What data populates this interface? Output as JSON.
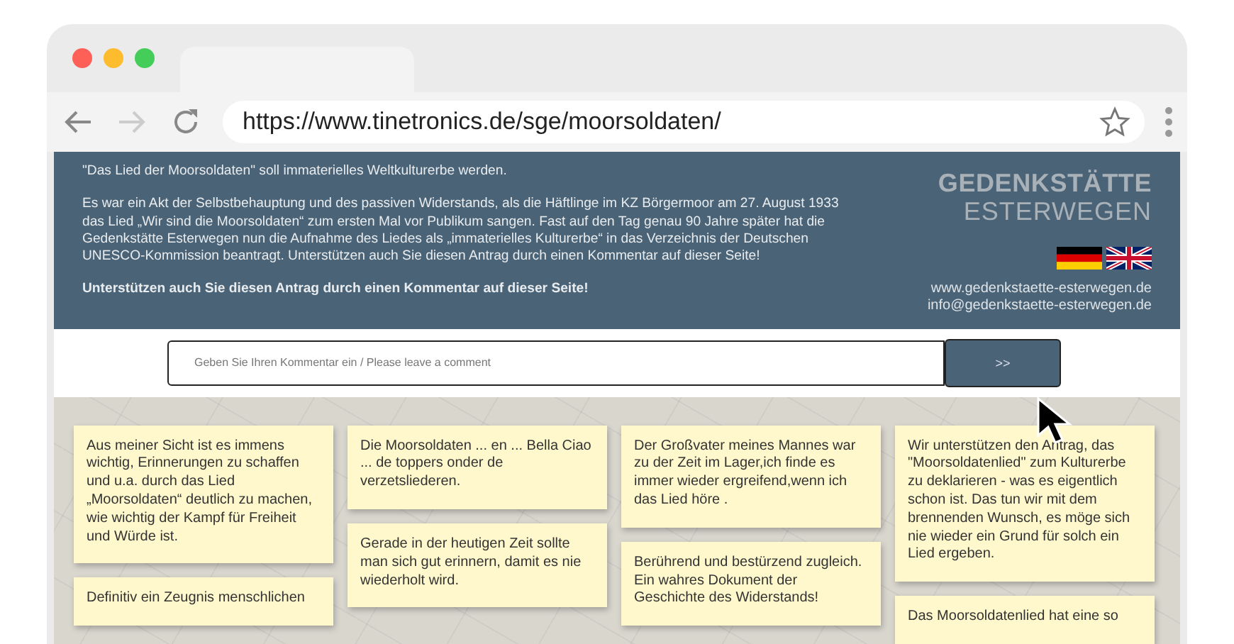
{
  "browser": {
    "url": "https://www.tinetronics.de/sge/moorsoldaten/"
  },
  "header": {
    "headline": "\"Das Lied der Moorsoldaten\" soll immaterielles Weltkulturerbe werden.",
    "paragraph": "Es war ein Akt der Selbstbehauptung und des passiven Widerstands, als die Häftlinge im KZ Börgermoor am 27. August 1933 das Lied „Wir sind die Moorsoldaten“ zum ersten Mal vor Publikum sangen. Fast auf den Tag genau 90 Jahre später hat die Gedenkstätte Esterwegen nun die Aufnahme des Liedes als „immaterielles Kulturerbe“ in das Verzeichnis der Deutschen UNESCO-Kommission beantragt. Unterstützen auch Sie diesen Antrag durch einen Kommentar auf dieser Seite!",
    "call_to_action": "Unterstützen auch Sie diesen Antrag durch einen Kommentar auf dieser Seite!",
    "logo_top": "GEDENKSTÄTTE",
    "logo_bottom": "ESTERWEGEN",
    "website": "www.gedenkstaette-esterwegen.de",
    "email": "info@gedenkstaette-esterwegen.de"
  },
  "comment_form": {
    "placeholder": "Geben Sie Ihren Kommentar ein / Please leave a comment",
    "submit": ">>"
  },
  "columns": [
    {
      "notes": [
        "Aus meiner Sicht ist es immens wichtig, Erinnerungen zu schaffen und u.a. durch das Lied „Moorsoldaten“ deutlich zu machen, wie wichtig der Kampf für Freiheit und Würde ist.",
        "Definitiv ein Zeugnis menschlichen"
      ]
    },
    {
      "notes": [
        "Die Moorsoldaten ... en ... Bella Ciao ... de toppers onder de verzetsliederen.",
        "Gerade in der heutigen Zeit sollte man sich gut erinnern, damit es nie wiederholt wird."
      ]
    },
    {
      "notes": [
        "Der Großvater meines Mannes war zu der Zeit im Lager,ich finde es immer wieder ergreifend,wenn ich das Lied höre .",
        "Berührend und bestürzend zugleich. Ein wahres Dokument der Geschichte des Widerstands!"
      ]
    },
    {
      "notes": [
        "Wir unterstützen den Antrag, das \"Moorsoldatenlied\" zum Kulturerbe zu deklarieren - was es eigentlich schon ist. Das tun wir mit dem brennenden Wunsch, es möge sich nie wieder ein Grund für solch ein Lied ergeben.",
        "Das Moorsoldatenlied hat eine so"
      ]
    }
  ]
}
